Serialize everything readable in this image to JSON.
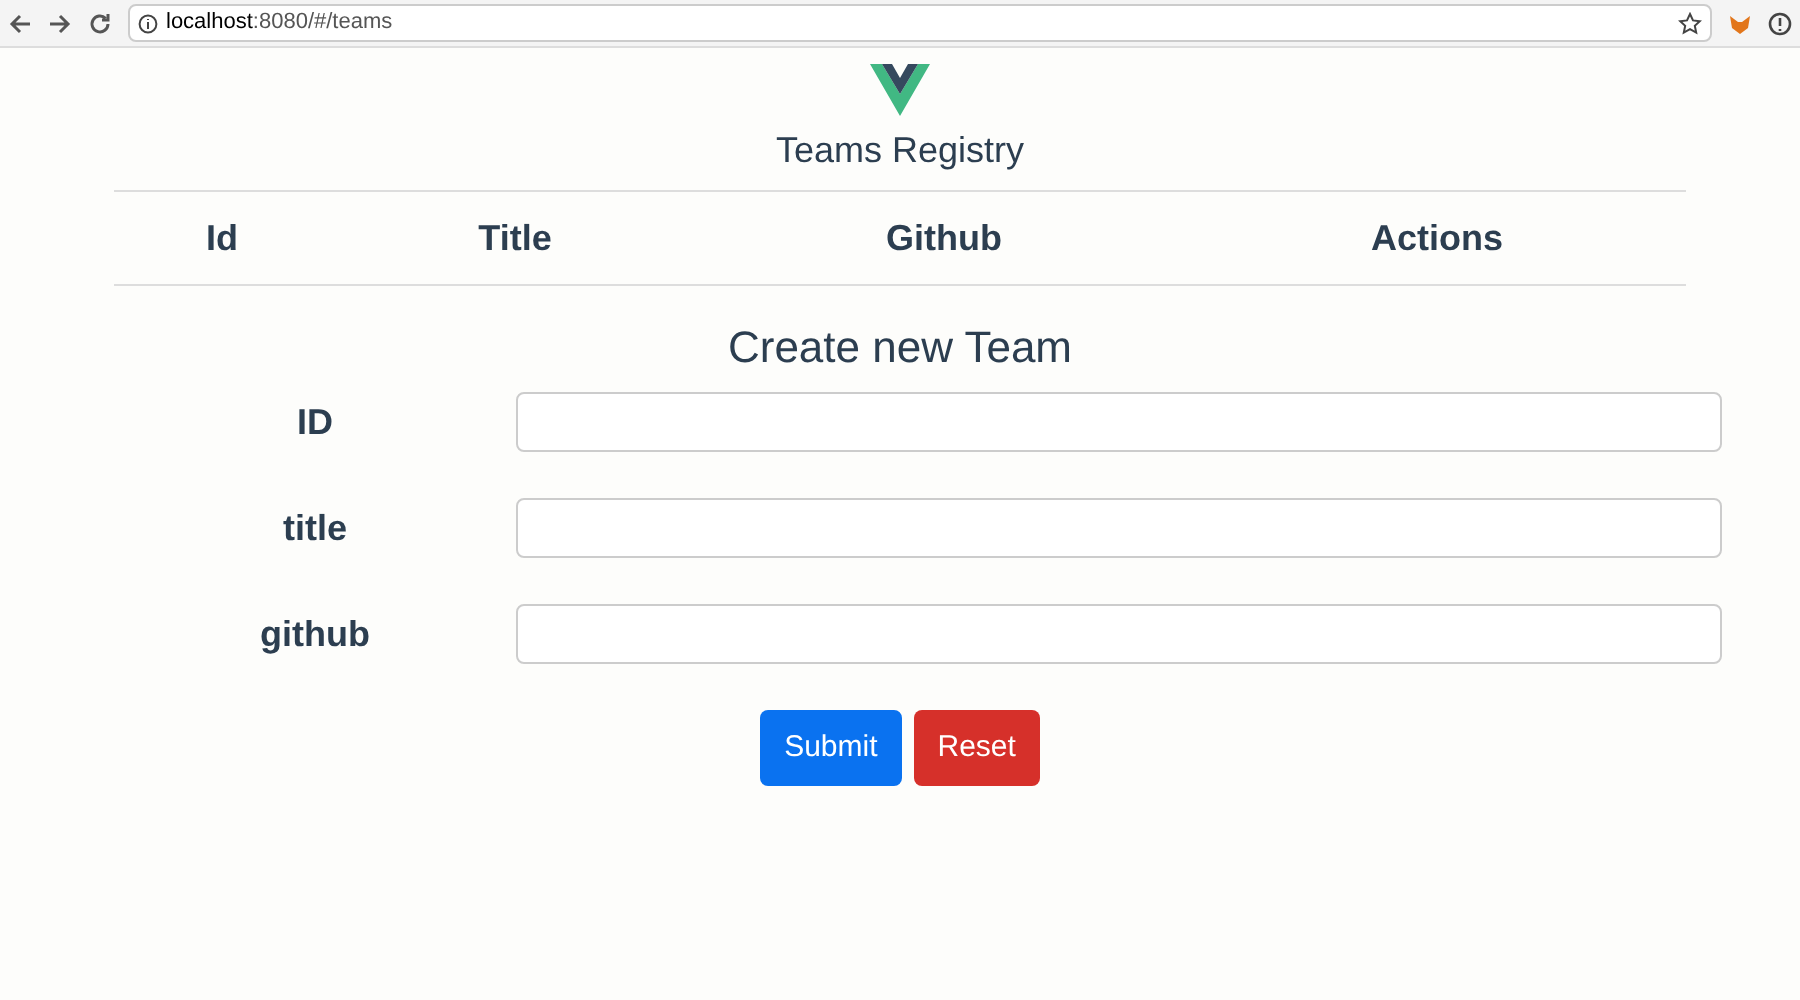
{
  "browser": {
    "address_host": "localhost",
    "address_path": ":8080/#/teams"
  },
  "header": {
    "title": "Teams Registry"
  },
  "table": {
    "columns": [
      "Id",
      "Title",
      "Github",
      "Actions"
    ]
  },
  "form": {
    "heading": "Create new Team",
    "fields": [
      {
        "label": "ID"
      },
      {
        "label": "title"
      },
      {
        "label": "github"
      }
    ],
    "buttons": [
      {
        "label": "Submit",
        "kind": "primary"
      },
      {
        "label": "Reset",
        "kind": "danger"
      }
    ]
  }
}
